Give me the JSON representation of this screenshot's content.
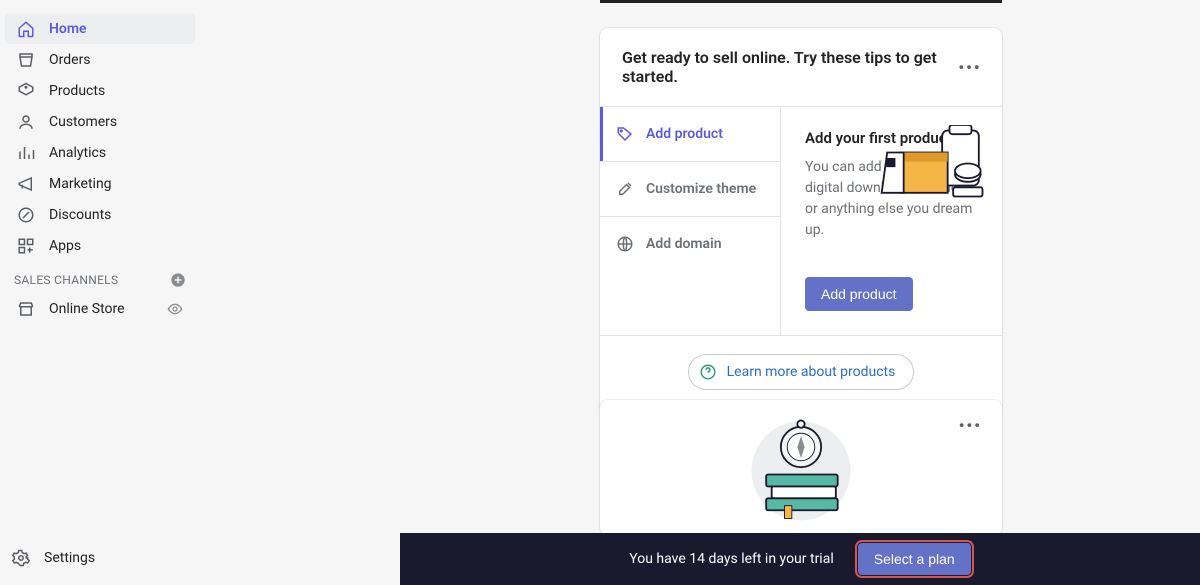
{
  "sidebar": {
    "items": [
      {
        "label": "Home",
        "icon": "home-icon"
      },
      {
        "label": "Orders",
        "icon": "orders-icon"
      },
      {
        "label": "Products",
        "icon": "products-icon"
      },
      {
        "label": "Customers",
        "icon": "customers-icon"
      },
      {
        "label": "Analytics",
        "icon": "analytics-icon"
      },
      {
        "label": "Marketing",
        "icon": "marketing-icon"
      },
      {
        "label": "Discounts",
        "icon": "discounts-icon"
      },
      {
        "label": "Apps",
        "icon": "apps-icon"
      }
    ],
    "channels_header": "SALES CHANNELS",
    "channels": [
      {
        "label": "Online Store",
        "icon": "store-icon"
      }
    ],
    "settings_label": "Settings"
  },
  "tips_card": {
    "title": "Get ready to sell online. Try these tips to get started.",
    "steps": [
      {
        "label": "Add product",
        "active": true
      },
      {
        "label": "Customize theme",
        "active": false
      },
      {
        "label": "Add domain",
        "active": false
      }
    ],
    "panel": {
      "heading": "Add your first product",
      "body": "You can add physical items, digital downloads, services, or anything else you dream up.",
      "cta": "Add product",
      "learn_more": "Learn more about products"
    }
  },
  "trial": {
    "message": "You have 14 days left in your trial",
    "cta": "Select a plan"
  }
}
